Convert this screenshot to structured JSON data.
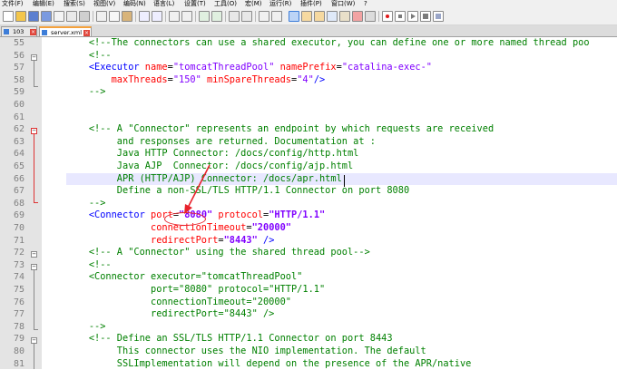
{
  "menu": [
    "文件(F)",
    "编辑(E)",
    "搜索(S)",
    "视图(V)",
    "编码(N)",
    "语言(L)",
    "设置(T)",
    "工具(O)",
    "宏(M)",
    "运行(R)",
    "插件(P)",
    "窗口(W)",
    "?"
  ],
  "tabs": [
    {
      "label": "103"
    },
    {
      "label": "server.xml"
    }
  ],
  "line_numbers": [
    "55",
    "56",
    "57",
    "58",
    "59",
    "60",
    "61",
    "62",
    "63",
    "64",
    "65",
    "66",
    "67",
    "68",
    "69",
    "70",
    "71",
    "72",
    "73",
    "74",
    "75",
    "76",
    "77",
    "78",
    "79",
    "80",
    "81"
  ],
  "code": {
    "l55": "<!--The connectors can use a shared executor, you can define one or more named thread poo",
    "l56": "<!--",
    "l57": {
      "t1": "<Executor",
      "a1": " name",
      "e1": "=",
      "v1": "\"tomcatThreadPool\"",
      "a2": " namePrefix",
      "e2": "=",
      "v2": "\"catalina-exec-\""
    },
    "l58": {
      "a1": "maxThreads",
      "e1": "=",
      "v1": "\"150\"",
      "a2": " minSpareThreads",
      "e2": "=",
      "v2": "\"4\"",
      "t1": "/>"
    },
    "l59": "-->",
    "l62": "<!-- A \"Connector\" represents an endpoint by which requests are received",
    "l63": "and responses are returned. Documentation at :",
    "l64": "Java HTTP Connector: /docs/config/http.html",
    "l65": "Java AJP  Connector: /docs/config/ajp.html",
    "l66": "APR (HTTP/AJP) Connector: /docs/apr.html",
    "l67": "Define a non-SSL/TLS HTTP/1.1 Connector on port 8080",
    "l68": "-->",
    "l69": {
      "t1": "<Connector",
      "a1": " port",
      "e1": "=",
      "v1": "\"8080\"",
      "a2": " protocol",
      "e2": "=",
      "v2": "\"HTTP/1.1\""
    },
    "l70": {
      "a1": "connectionTimeout",
      "e1": "=",
      "v1": "\"20000\""
    },
    "l71": {
      "a1": "redirectPort",
      "e1": "=",
      "v1": "\"8443\"",
      "t1": " />"
    },
    "l72": "<!-- A \"Connector\" using the shared thread pool-->",
    "l73": "<!--",
    "l74": "<Connector executor=\"tomcatThreadPool\"",
    "l75": "port=\"8080\" protocol=\"HTTP/1.1\"",
    "l76": "connectionTimeout=\"20000\"",
    "l77": "redirectPort=\"8443\" />",
    "l78": "-->",
    "l79": "<!-- Define an SSL/TLS HTTP/1.1 Connector on port 8443",
    "l80": "This connector uses the NIO implementation. The default",
    "l81": "SSLImplementation will depend on the presence of the APR/native"
  },
  "colors": {
    "comment": "#008000",
    "tag": "#0000ff",
    "attribute": "#ff0000",
    "value": "#8000ff",
    "annotation": "#e8212b",
    "current_line": "#e8e8ff"
  },
  "toolbar_icons": [
    "new-icon",
    "open-icon",
    "save-icon",
    "save-all-icon",
    "close-icon",
    "close-all-icon",
    "print-icon",
    "cut-icon",
    "copy-icon",
    "paste-icon",
    "undo-icon",
    "redo-icon",
    "find-icon",
    "replace-icon",
    "zoom-in-icon",
    "zoom-out-icon",
    "sync-v-icon",
    "sync-h-icon",
    "wrap-icon",
    "all-chars-icon",
    "indent-guide-icon",
    "lang-icon",
    "doc-map-icon",
    "func-list-icon",
    "folder-workspace-icon",
    "monitor-icon",
    "record-macro-icon",
    "stop-macro-icon",
    "play-macro-icon",
    "run-macro-multiple-icon",
    "save-macro-icon"
  ]
}
